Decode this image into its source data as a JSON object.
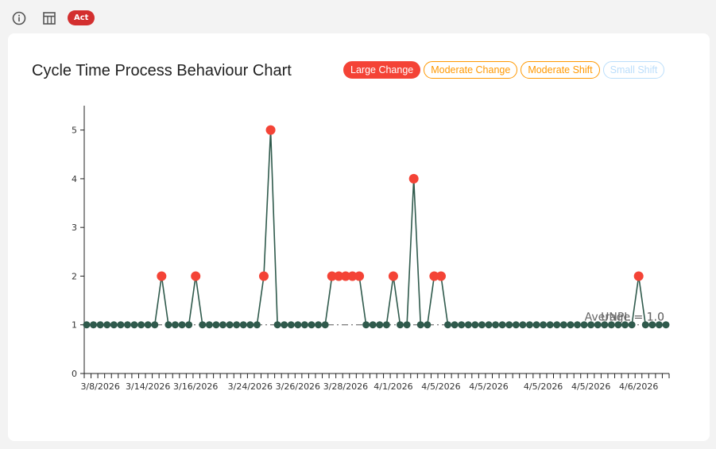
{
  "toolbar": {
    "info_icon": "info-icon",
    "table_icon": "table-icon",
    "act_label": "Act"
  },
  "chart_data": {
    "type": "line",
    "title": "Cycle Time Process Behaviour Chart",
    "legend": [
      {
        "label": "Large Change",
        "style": "filled",
        "color": "#f44336"
      },
      {
        "label": "Moderate Change",
        "style": "outline",
        "color": "#ff9800"
      },
      {
        "label": "Moderate Shift",
        "style": "outline",
        "color": "#ff9800"
      },
      {
        "label": "Small Shift",
        "style": "outline",
        "color": "#bbdefb"
      }
    ],
    "legend_position": "top-right",
    "ylim": [
      0,
      5.5
    ],
    "yticks": [
      0,
      1,
      2,
      3,
      4,
      5
    ],
    "xtick_labels": [
      "3/8/2026",
      "3/14/2026",
      "3/16/2026",
      "3/24/2026",
      "3/26/2026",
      "3/28/2026",
      "4/1/2026",
      "4/5/2026",
      "4/5/2026",
      "4/5/2026",
      "4/5/2026",
      "4/6/2026"
    ],
    "values": [
      1,
      1,
      1,
      1,
      1,
      1,
      1,
      1,
      1,
      1,
      1,
      2,
      1,
      1,
      1,
      1,
      2,
      1,
      1,
      1,
      1,
      1,
      1,
      1,
      1,
      1,
      2,
      5,
      1,
      1,
      1,
      1,
      1,
      1,
      1,
      1,
      2,
      2,
      2,
      2,
      2,
      1,
      1,
      1,
      1,
      2,
      1,
      1,
      4,
      1,
      1,
      2,
      2,
      1,
      1,
      1,
      1,
      1,
      1,
      1,
      1,
      1,
      1,
      1,
      1,
      1,
      1,
      1,
      1,
      1,
      1,
      1,
      1,
      1,
      1,
      1,
      1,
      1,
      1,
      1,
      1,
      2,
      1,
      1,
      1,
      1
    ],
    "average": {
      "label": "Average = 1.0",
      "value": 1.0
    },
    "unpl": {
      "label": "UNPL = 1.0",
      "value": 1.0
    },
    "colors": {
      "line": "#2f5a4c",
      "normal": "#2f5a4c",
      "signal": "#f44336"
    }
  }
}
